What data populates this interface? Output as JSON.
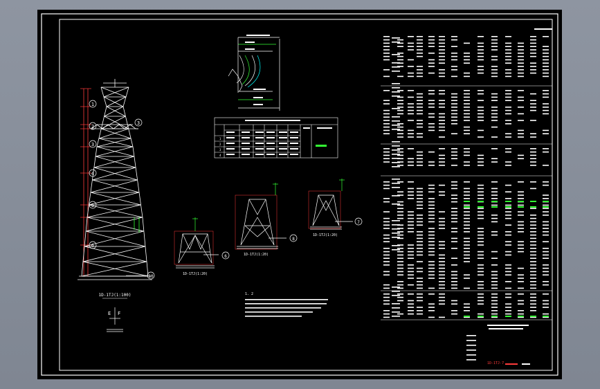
{
  "viewer": {
    "background": "#8a909c",
    "sheet_color": "#000000"
  },
  "colors": {
    "line": "#ffffff",
    "dim": "#ff3b3b",
    "accent": "#33ff33",
    "callout": "#ffffff",
    "cyan": "#00ffff"
  },
  "tower_labels": {
    "circles": [
      "1",
      "2",
      "3",
      "4",
      "5",
      "6"
    ],
    "mark_3": "3",
    "mark_10": "10",
    "caption": "1D-1TJ(1:100)"
  },
  "ground": {
    "mark_left": "E",
    "mark_right": "F"
  },
  "sections": [
    {
      "caption": "1D-1TJ(1:20)",
      "mark": "6"
    },
    {
      "caption": "1D-1TJ(1:20)",
      "mark": "8"
    },
    {
      "caption": "1D-1TJ(1:20)",
      "mark": "7"
    }
  ],
  "insulator_table": {
    "head_row1": [
      "",
      "",
      "",
      "",
      ""
    ],
    "row_labels": [
      "1",
      "2",
      "3",
      "4"
    ],
    "callout": "1500"
  },
  "notes": {
    "title": "1. 2"
  },
  "schedule": {
    "top_digits": [
      "2",
      "2",
      "2",
      "3",
      "7",
      "7",
      "3"
    ],
    "col_numbers": [
      "1",
      "2",
      "3",
      "4",
      "5",
      "6",
      "7",
      "8",
      "9",
      "10",
      "11",
      "12",
      "13",
      "14"
    ],
    "bottom_mark": "1D-1TJ-7"
  }
}
